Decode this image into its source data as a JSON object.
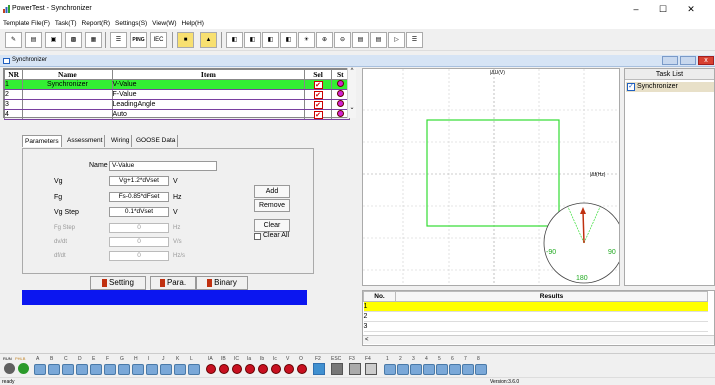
{
  "window": {
    "title": "PowerTest - Synchronizer",
    "minimize": "–",
    "maximize": "☐",
    "close": "✕"
  },
  "menu": [
    "Template File(F)",
    "Task(T)",
    "Report(R)",
    "Settings(S)",
    "View(W)",
    "Help(H)"
  ],
  "toolbar": {
    "ping_label": "PING",
    "iec_label": "IEC"
  },
  "panel": {
    "title": "Synchronizer"
  },
  "grid": {
    "headers": [
      "NR",
      "Name",
      "Item",
      "Sel",
      "St"
    ],
    "rows": [
      {
        "nr": "1",
        "name": "Synchronizer",
        "item": "V-Value",
        "sel": "✔"
      },
      {
        "nr": "2",
        "name": "",
        "item": "F-Value",
        "sel": "✔"
      },
      {
        "nr": "3",
        "name": "",
        "item": "LeadingAngle",
        "sel": "✔"
      },
      {
        "nr": "4",
        "name": "",
        "item": "Auto",
        "sel": "✔"
      }
    ]
  },
  "tabs": [
    "Parameters",
    "Assessment",
    "Wiring",
    "GOOSE Data"
  ],
  "params": {
    "name_label": "Name",
    "name_value": "V-Value",
    "vg_label": "Vg",
    "vg_value": "Vg+1.2*dVset",
    "vg_unit": "V",
    "fg_label": "Fg",
    "fg_value": "Fs-0.85*dFset",
    "fg_unit": "Hz",
    "vgstep_label": "Vg Step",
    "vgstep_value": "0.1*dVset",
    "vgstep_unit": "V",
    "fgstep_label": "Fg Step",
    "fgstep_value": "0",
    "fgstep_unit": "Hz",
    "dvdt_label": "dv/dt",
    "dvdt_value": "0",
    "dvdt_unit": "V/s",
    "dfdt_label": "df/dt",
    "dfdt_value": "0",
    "dfdt_unit": "Hz/s",
    "add": "Add",
    "remove": "Remove",
    "clear": "Clear",
    "clear_all": "Clear All"
  },
  "bottom_buttons": {
    "setting": "Setting",
    "para": "Para.",
    "binary": "Binary"
  },
  "chart": {
    "y_label": "|ΔU(V)",
    "x_label": "|Δf(Hz)",
    "phase_left": "-90",
    "phase_right": "90",
    "phase_bottom": "180"
  },
  "tasklist": {
    "header": "Task List",
    "item": "Synchronizer"
  },
  "results": {
    "headers": [
      "No.",
      "Results"
    ],
    "rows": [
      "1",
      "2",
      "3"
    ]
  },
  "bottombar": {
    "run_label": "RUN",
    "phase_label": "PHLB",
    "channels_a": [
      "A",
      "B",
      "C",
      "D",
      "E",
      "F",
      "G",
      "H",
      "I",
      "J",
      "K",
      "L"
    ],
    "channels_b": [
      "IA",
      "IB",
      "IC",
      "Ia",
      "Ib",
      "Ic",
      "V",
      "O"
    ],
    "f_keys": [
      "F2",
      "ESC",
      "F3",
      "F4"
    ],
    "channels_c": [
      "1",
      "2",
      "3",
      "4",
      "5",
      "6",
      "7",
      "8"
    ]
  },
  "status": {
    "left": "ready",
    "version": "Version:3.6.0"
  }
}
